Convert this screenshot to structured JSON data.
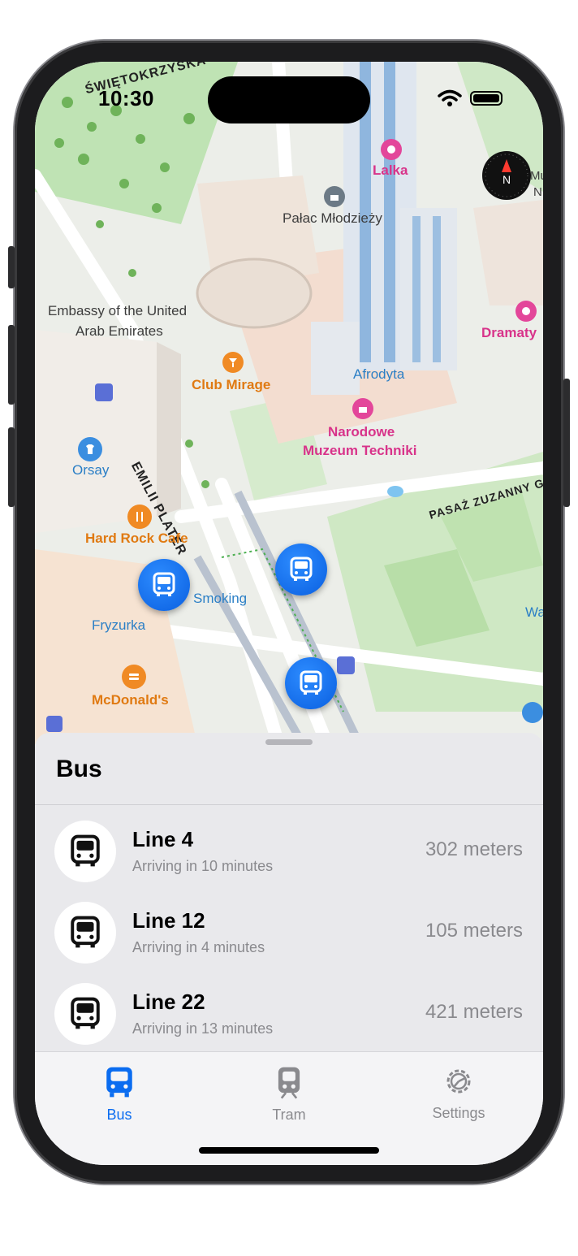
{
  "status_bar": {
    "time": "10:30"
  },
  "map": {
    "labels": {
      "swietokrzyska": "ŚWIĘTOKRZYSKA",
      "lalka": "Lalka",
      "palac": "Pałac Młodzieży",
      "embassy_1": "Embassy of the United",
      "embassy_2": "Arab Emirates",
      "dramaty": "Dramaty",
      "club_mirage": "Club Mirage",
      "afrodyta": "Afrodyta",
      "orsay": "Orsay",
      "narodowe_1": "Narodowe",
      "narodowe_2": "Muzeum Techniki",
      "plater": "EMILII PLATER",
      "pasaz": "PASAŻ ZUZANNY G",
      "hard_rock": "Hard Rock Cafe",
      "smoking": "Smoking",
      "fryzurka": "Fryzurka",
      "mcdonalds": "McDonald's",
      "wa": "Wa",
      "mu": "Mu",
      "n": "N"
    },
    "compass_letter": "N"
  },
  "sheet": {
    "title": "Bus",
    "rows": [
      {
        "title": "Line 4",
        "subtitle": "Arriving in 10 minutes",
        "distance": "302 meters"
      },
      {
        "title": "Line 12",
        "subtitle": "Arriving in 4 minutes",
        "distance": "105 meters"
      },
      {
        "title": "Line 22",
        "subtitle": "Arriving in 13 minutes",
        "distance": "421 meters"
      }
    ]
  },
  "tabs": [
    {
      "label": "Bus",
      "selected": true
    },
    {
      "label": "Tram",
      "selected": false
    },
    {
      "label": "Settings",
      "selected": false
    }
  ],
  "colors": {
    "accent": "#0a6cf0",
    "inactive": "#8a8a8e"
  }
}
